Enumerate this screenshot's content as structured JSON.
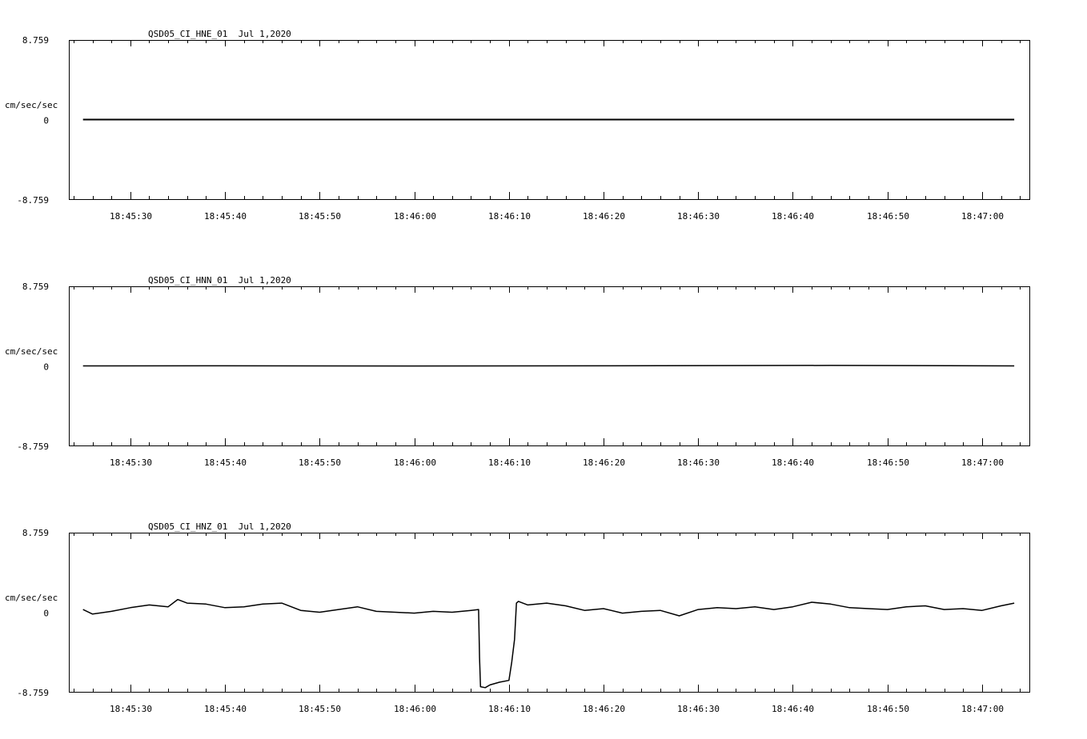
{
  "colors": {
    "background": "#ffffff",
    "ink": "#000000"
  },
  "chart_data": [
    {
      "type": "line",
      "title": "QSD05_CI_HNE_01  Jul 1,2020",
      "ylabel": "cm/sec/sec",
      "ylim": [
        -8.759,
        8.759
      ],
      "ytick_labels": {
        "top": "8.759",
        "zero": "0",
        "bottom": "-8.759"
      },
      "xlim": [
        "18:45:23.5",
        "18:47:05.0"
      ],
      "xtick_labels": [
        "18:45:30",
        "18:45:40",
        "18:45:50",
        "18:46:00",
        "18:46:10",
        "18:46:20",
        "18:46:30",
        "18:46:40",
        "18:46:50",
        "18:47:00"
      ],
      "grid": false,
      "series": [
        {
          "x": [
            "18:45:25",
            "18:47:03.4"
          ],
          "y": [
            0,
            0
          ]
        }
      ]
    },
    {
      "type": "line",
      "title": "QSD05_CI_HNN_01  Jul 1,2020",
      "ylabel": "cm/sec/sec",
      "ylim": [
        -8.759,
        8.759
      ],
      "ytick_labels": {
        "top": "8.759",
        "zero": "0",
        "bottom": "-8.759"
      },
      "xlim": [
        "18:45:23.5",
        "18:47:05.0"
      ],
      "xtick_labels": [
        "18:45:30",
        "18:45:40",
        "18:45:50",
        "18:46:00",
        "18:46:10",
        "18:46:20",
        "18:46:30",
        "18:46:40",
        "18:46:50",
        "18:47:00"
      ],
      "grid": false,
      "series": [
        {
          "x": [
            "18:45:25",
            "18:45:40",
            "18:46:00",
            "18:46:20",
            "18:46:44",
            "18:47:03.4"
          ],
          "y": [
            0,
            0.01,
            -0.01,
            0.01,
            0.05,
            0
          ]
        }
      ]
    },
    {
      "type": "line",
      "title": "QSD05_CI_HNZ_01  Jul 1,2020",
      "ylabel": "cm/sec/sec",
      "ylim": [
        -8.759,
        8.759
      ],
      "ytick_labels": {
        "top": "8.759",
        "zero": "0",
        "bottom": "-8.759"
      },
      "xlim": [
        "18:45:23.5",
        "18:47:05.0"
      ],
      "xtick_labels": [
        "18:45:30",
        "18:45:40",
        "18:45:50",
        "18:46:00",
        "18:46:10",
        "18:46:20",
        "18:46:30",
        "18:46:40",
        "18:46:50",
        "18:47:00"
      ],
      "grid": false,
      "series": [
        {
          "x": [
            "18:45:25",
            "18:45:26",
            "18:45:28",
            "18:45:30",
            "18:45:32",
            "18:45:34",
            "18:45:35",
            "18:45:36",
            "18:45:38",
            "18:45:40",
            "18:45:42",
            "18:45:44",
            "18:45:46",
            "18:45:48",
            "18:45:50",
            "18:45:52",
            "18:45:54",
            "18:45:56",
            "18:45:58",
            "18:46:00",
            "18:46:02",
            "18:46:04",
            "18:46:06",
            "18:46:06.8",
            "18:46:06.9",
            "18:46:07",
            "18:46:07.5",
            "18:46:08",
            "18:46:09",
            "18:46:10",
            "18:46:10.3",
            "18:46:10.6",
            "18:46:10.8",
            "18:46:11",
            "18:46:12",
            "18:46:14",
            "18:46:16",
            "18:46:18",
            "18:46:20",
            "18:46:22",
            "18:46:24",
            "18:46:26",
            "18:46:28",
            "18:46:30",
            "18:46:32",
            "18:46:34",
            "18:46:36",
            "18:46:38",
            "18:46:40",
            "18:46:42",
            "18:46:44",
            "18:46:46",
            "18:46:48",
            "18:46:50",
            "18:46:52",
            "18:46:54",
            "18:46:56",
            "18:46:58",
            "18:47:00",
            "18:47:02",
            "18:47:03.4"
          ],
          "y": [
            0.3,
            -0.2,
            0.1,
            0.5,
            0.8,
            0.6,
            1.4,
            1.0,
            0.9,
            0.5,
            0.6,
            0.9,
            1.0,
            0.2,
            0.0,
            0.3,
            0.6,
            0.1,
            0.0,
            -0.1,
            0.1,
            0.0,
            0.2,
            0.3,
            -5.0,
            -8.2,
            -8.3,
            -8.0,
            -7.7,
            -7.5,
            -5.5,
            -3.0,
            1.0,
            1.2,
            0.8,
            1.0,
            0.7,
            0.2,
            0.4,
            -0.1,
            0.1,
            0.2,
            -0.4,
            0.3,
            0.5,
            0.4,
            0.6,
            0.3,
            0.6,
            1.1,
            0.9,
            0.5,
            0.4,
            0.3,
            0.6,
            0.7,
            0.3,
            0.4,
            0.2,
            0.7,
            1.0
          ]
        }
      ]
    }
  ]
}
